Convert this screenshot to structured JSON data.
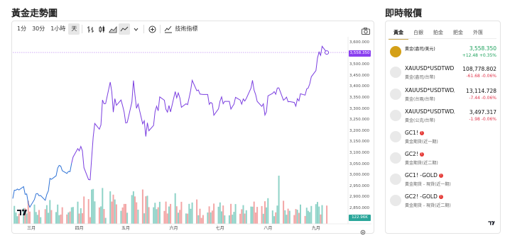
{
  "left_title": "黃金走勢圖",
  "right_title": "即時報價",
  "toolbar": {
    "intervals": [
      "1分",
      "30分",
      "1小時",
      "天"
    ],
    "active_interval": "天",
    "indicators_label": "技術指標"
  },
  "chart_data": {
    "type": "line",
    "series_name": "",
    "y_ticks": [
      "3,600.000",
      "3,550.000",
      "3,500.000",
      "3,450.000",
      "3,400.000",
      "3,350.000",
      "3,300.000",
      "3,250.000",
      "3,200.000",
      "3,150.000",
      "3,100.000",
      "3,050.000",
      "3,000.000",
      "2,950.000",
      "2,900.000",
      "2,850.000"
    ],
    "x_ticks": [
      "三月",
      "四月",
      "五月",
      "六月",
      "七月",
      "八月",
      "九月"
    ],
    "ylim": [
      2825,
      3620
    ],
    "last_price_label": "3,558.350",
    "volume_label": "122.96K",
    "x_range": [
      "2025-02-17",
      "2025-09-02"
    ],
    "prices": [
      [
        "2025-02-17",
        2897
      ],
      [
        "2025-02-18",
        2935
      ],
      [
        "2025-02-19",
        2935
      ],
      [
        "2025-02-20",
        2940
      ],
      [
        "2025-02-21",
        2936
      ],
      [
        "2025-02-24",
        2951
      ],
      [
        "2025-02-25",
        2916
      ],
      [
        "2025-02-26",
        2918
      ],
      [
        "2025-02-27",
        2876
      ],
      [
        "2025-02-28",
        2858
      ],
      [
        "2025-03-03",
        2893
      ],
      [
        "2025-03-04",
        2918
      ],
      [
        "2025-03-05",
        2920
      ],
      [
        "2025-03-06",
        2910
      ],
      [
        "2025-03-07",
        2911
      ],
      [
        "2025-03-10",
        2889
      ],
      [
        "2025-03-11",
        2916
      ],
      [
        "2025-03-12",
        2932
      ],
      [
        "2025-03-13",
        2988
      ],
      [
        "2025-03-14",
        2984
      ],
      [
        "2025-03-17",
        3000
      ],
      [
        "2025-03-18",
        3035
      ],
      [
        "2025-03-19",
        3047
      ],
      [
        "2025-03-20",
        3044
      ],
      [
        "2025-03-21",
        3023
      ],
      [
        "2025-03-24",
        3011
      ],
      [
        "2025-03-25",
        3020
      ],
      [
        "2025-03-26",
        3019
      ],
      [
        "2025-03-27",
        3057
      ],
      [
        "2025-03-28",
        3085
      ],
      [
        "2025-03-31",
        3123
      ],
      [
        "2025-04-01",
        3113
      ],
      [
        "2025-04-02",
        3133
      ],
      [
        "2025-04-03",
        3113
      ],
      [
        "2025-04-04",
        3037
      ],
      [
        "2025-04-07",
        2983
      ],
      [
        "2025-04-08",
        2982
      ],
      [
        "2025-04-09",
        3083
      ],
      [
        "2025-04-10",
        3175
      ],
      [
        "2025-04-11",
        3237
      ],
      [
        "2025-04-14",
        3211
      ],
      [
        "2025-04-15",
        3230
      ],
      [
        "2025-04-16",
        3343
      ],
      [
        "2025-04-17",
        3326
      ],
      [
        "2025-04-18",
        3327
      ],
      [
        "2025-04-21",
        3424
      ],
      [
        "2025-04-22",
        3380
      ],
      [
        "2025-04-23",
        3288
      ],
      [
        "2025-04-24",
        3349
      ],
      [
        "2025-04-25",
        3319
      ],
      [
        "2025-04-28",
        3343
      ],
      [
        "2025-04-29",
        3317
      ],
      [
        "2025-04-30",
        3288
      ],
      [
        "2025-05-01",
        3239
      ],
      [
        "2025-05-02",
        3241
      ],
      [
        "2025-05-05",
        3334
      ],
      [
        "2025-05-06",
        3431
      ],
      [
        "2025-05-07",
        3366
      ],
      [
        "2025-05-08",
        3305
      ],
      [
        "2025-05-09",
        3325
      ],
      [
        "2025-05-12",
        3235
      ],
      [
        "2025-05-13",
        3249
      ],
      [
        "2025-05-14",
        3178
      ],
      [
        "2025-05-15",
        3240
      ],
      [
        "2025-05-16",
        3204
      ],
      [
        "2025-05-19",
        3228
      ],
      [
        "2025-05-20",
        3290
      ],
      [
        "2025-05-21",
        3315
      ],
      [
        "2025-05-22",
        3294
      ],
      [
        "2025-05-23",
        3357
      ],
      [
        "2025-05-26",
        3342
      ],
      [
        "2025-05-27",
        3301
      ],
      [
        "2025-05-28",
        3288
      ],
      [
        "2025-05-29",
        3318
      ],
      [
        "2025-05-30",
        3289
      ],
      [
        "2025-06-02",
        3381
      ],
      [
        "2025-06-03",
        3353
      ],
      [
        "2025-06-04",
        3375
      ],
      [
        "2025-06-05",
        3353
      ],
      [
        "2025-06-06",
        3310
      ],
      [
        "2025-06-09",
        3326
      ],
      [
        "2025-06-10",
        3322
      ],
      [
        "2025-06-11",
        3354
      ],
      [
        "2025-06-12",
        3386
      ],
      [
        "2025-06-13",
        3432
      ],
      [
        "2025-06-16",
        3385
      ],
      [
        "2025-06-17",
        3388
      ],
      [
        "2025-06-18",
        3370
      ],
      [
        "2025-06-19",
        3369
      ],
      [
        "2025-06-20",
        3368
      ],
      [
        "2025-06-23",
        3368
      ],
      [
        "2025-06-24",
        3323
      ],
      [
        "2025-06-25",
        3332
      ],
      [
        "2025-06-26",
        3327
      ],
      [
        "2025-06-27",
        3274
      ],
      [
        "2025-06-30",
        3303
      ],
      [
        "2025-07-01",
        3338
      ],
      [
        "2025-07-02",
        3357
      ],
      [
        "2025-07-03",
        3326
      ],
      [
        "2025-07-04",
        3337
      ],
      [
        "2025-07-07",
        3337
      ],
      [
        "2025-07-08",
        3302
      ],
      [
        "2025-07-09",
        3313
      ],
      [
        "2025-07-10",
        3324
      ],
      [
        "2025-07-11",
        3355
      ],
      [
        "2025-07-14",
        3343
      ],
      [
        "2025-07-15",
        3324
      ],
      [
        "2025-07-16",
        3348
      ],
      [
        "2025-07-17",
        3338
      ],
      [
        "2025-07-18",
        3350
      ],
      [
        "2025-07-21",
        3397
      ],
      [
        "2025-07-22",
        3432
      ],
      [
        "2025-07-23",
        3388
      ],
      [
        "2025-07-24",
        3368
      ],
      [
        "2025-07-25",
        3337
      ],
      [
        "2025-07-28",
        3314
      ],
      [
        "2025-07-29",
        3326
      ],
      [
        "2025-07-30",
        3275
      ],
      [
        "2025-07-31",
        3290
      ],
      [
        "2025-08-01",
        3362
      ],
      [
        "2025-08-04",
        3373
      ],
      [
        "2025-08-05",
        3381
      ],
      [
        "2025-08-06",
        3369
      ],
      [
        "2025-08-07",
        3397
      ],
      [
        "2025-08-08",
        3398
      ],
      [
        "2025-08-11",
        3342
      ],
      [
        "2025-08-12",
        3348
      ],
      [
        "2025-08-13",
        3356
      ],
      [
        "2025-08-14",
        3335
      ],
      [
        "2025-08-15",
        3336
      ],
      [
        "2025-08-18",
        3332
      ],
      [
        "2025-08-19",
        3315
      ],
      [
        "2025-08-20",
        3349
      ],
      [
        "2025-08-21",
        3339
      ],
      [
        "2025-08-22",
        3371
      ],
      [
        "2025-08-25",
        3365
      ],
      [
        "2025-08-26",
        3393
      ],
      [
        "2025-08-27",
        3397
      ],
      [
        "2025-08-28",
        3416
      ],
      [
        "2025-08-29",
        3448
      ],
      [
        "2025-09-01",
        3476
      ],
      [
        "2025-09-02",
        3533
      ],
      [
        "2025-09-03",
        3560
      ],
      [
        "2025-09-04",
        3545
      ],
      [
        "2025-09-05",
        3586
      ],
      [
        "2025-09-08",
        3558
      ]
    ]
  },
  "quote_tabs": [
    "黃金",
    "白銀",
    "鉑金",
    "鈀金",
    "外匯"
  ],
  "active_quote_tab": "黃金",
  "quotes": [
    {
      "name": "黃金(盎司/美元)",
      "sub": "",
      "value": "3,558.350",
      "change": "+12.48 +0.35%",
      "dir": "pos",
      "highlight": true
    },
    {
      "name": "XAUUSD*USDTWD",
      "sub": "黃金(盎司/台幣)",
      "value": "108,778.802",
      "change": "-61.68 -0.06%",
      "dir": "neg"
    },
    {
      "name": "XAUUSD*USDTWD/8.",
      "sub": "黃金(台兩/台幣)",
      "value": "13,114.728",
      "change": "-7.44 -0.06%",
      "dir": "neg"
    },
    {
      "name": "XAUUSD*USDTWD/3.",
      "sub": "黃金(公克/台幣)",
      "value": "3,497.317",
      "change": "-1.98 -0.06%",
      "dir": "neg"
    },
    {
      "name": "GC1!",
      "sub": "黃金期貨(近一期)",
      "value": "",
      "change": "",
      "warn": true
    },
    {
      "name": "GC2!",
      "sub": "黃金期貨(近二期)",
      "value": "",
      "change": "",
      "warn": true
    },
    {
      "name": "GC1! -GOLD",
      "sub": "黃金期貨 - 現貨(近一期)",
      "value": "",
      "change": "",
      "warn": true
    },
    {
      "name": "GC2! -GOLD",
      "sub": "黃金期貨 - 現貨(近二期)",
      "value": "",
      "change": "",
      "warn": true
    }
  ]
}
